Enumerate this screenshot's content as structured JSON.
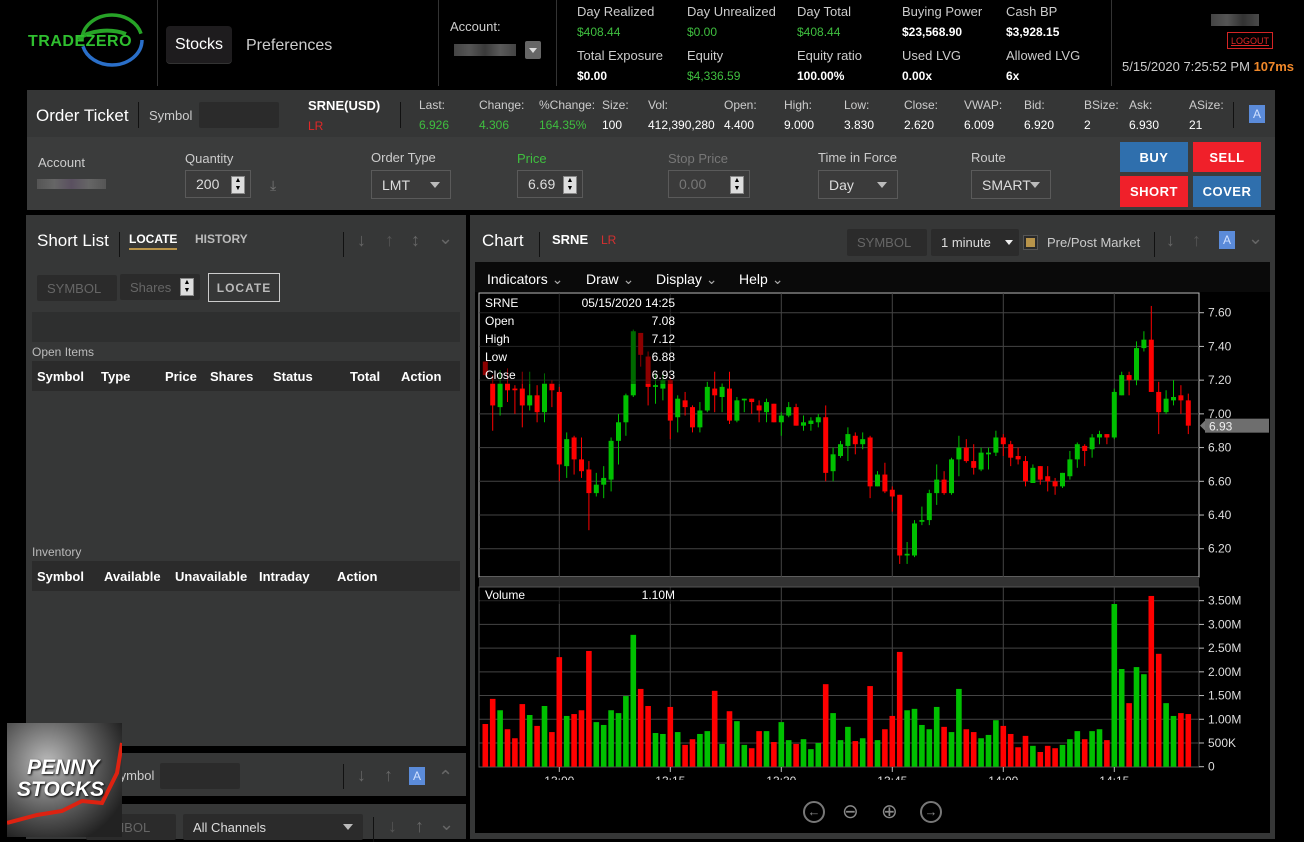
{
  "header": {
    "logo": "TRADEZERO",
    "nav": [
      {
        "label": "Stocks",
        "active": true
      },
      {
        "label": "Preferences",
        "active": false
      }
    ],
    "account_label": "Account:",
    "stats": [
      {
        "label": "Day Realized",
        "value": "$408.44",
        "color": "#3fbf3f"
      },
      {
        "label": "Total Exposure",
        "value": "$0.00",
        "color": "#ffffff"
      },
      {
        "label": "Day Unrealized",
        "value": "$0.00",
        "color": "#3fbf3f"
      },
      {
        "label": "Equity",
        "value": "$4,336.59",
        "color": "#3fbf3f"
      },
      {
        "label": "Day Total",
        "value": "$408.44",
        "color": "#3fbf3f"
      },
      {
        "label": "Equity ratio",
        "value": "100.00%",
        "color": "#ffffff"
      },
      {
        "label": "Buying Power",
        "value": "$23,568.90",
        "color": "#ffffff"
      },
      {
        "label": "Used LVG",
        "value": "0.00x",
        "color": "#ffffff"
      },
      {
        "label": "Cash BP",
        "value": "$3,928.15",
        "color": "#ffffff"
      },
      {
        "label": "Allowed LVG",
        "value": "6x",
        "color": "#ffffff"
      }
    ],
    "logout": "LOGOUT",
    "datetime": "5/15/2020 7:25:52 PM",
    "latency": "107ms"
  },
  "order_ticket": {
    "title": "Order Ticket",
    "symbol_label": "Symbol",
    "symbol": "SRNE(USD)",
    "route_tag": "LR",
    "a_button": "A",
    "quotes": [
      {
        "label": "Last:",
        "value": "6.926",
        "color": "#3fbf3f"
      },
      {
        "label": "Change:",
        "value": "4.306",
        "color": "#3fbf3f"
      },
      {
        "label": "%Change:",
        "value": "164.35%",
        "color": "#3fbf3f"
      },
      {
        "label": "Size:",
        "value": "100",
        "color": "#ffffff"
      },
      {
        "label": "Vol:",
        "value": "412,390,280",
        "color": "#ffffff"
      },
      {
        "label": "Open:",
        "value": "4.400",
        "color": "#ffffff"
      },
      {
        "label": "High:",
        "value": "9.000",
        "color": "#ffffff"
      },
      {
        "label": "Low:",
        "value": "3.830",
        "color": "#ffffff"
      },
      {
        "label": "Close:",
        "value": "2.620",
        "color": "#ffffff"
      },
      {
        "label": "VWAP:",
        "value": "6.009",
        "color": "#ffffff"
      },
      {
        "label": "Bid:",
        "value": "6.920",
        "color": "#ffffff"
      },
      {
        "label": "BSize:",
        "value": "2",
        "color": "#ffffff"
      },
      {
        "label": "Ask:",
        "value": "6.930",
        "color": "#ffffff"
      },
      {
        "label": "ASize:",
        "value": "21",
        "color": "#ffffff"
      }
    ],
    "form": {
      "account_label": "Account",
      "quantity_label": "Quantity",
      "quantity": "200",
      "order_type_label": "Order Type",
      "order_type": "LMT",
      "price_label": "Price",
      "price": "6.69",
      "stop_price_label": "Stop Price",
      "stop_price": "0.00",
      "tif_label": "Time in Force",
      "tif": "Day",
      "route_label": "Route",
      "route": "SMART"
    },
    "buttons": {
      "buy": "BUY",
      "sell": "SELL",
      "short": "SHORT",
      "cover": "COVER"
    },
    "colors": {
      "buy": "#2f6fad",
      "sell": "#f0202a"
    }
  },
  "short_list": {
    "title": "Short List",
    "tabs": [
      {
        "label": "LOCATE",
        "active": true
      },
      {
        "label": "HISTORY",
        "active": false
      }
    ],
    "symbol_placeholder": "SYMBOL",
    "shares_placeholder": "Shares",
    "locate_button": "LOCATE",
    "open_items_label": "Open Items",
    "open_items_columns": [
      "Symbol",
      "Type",
      "Price",
      "Shares",
      "Status",
      "Total",
      "Action"
    ],
    "inventory_label": "Inventory",
    "inventory_columns": [
      "Symbol",
      "Available",
      "Unavailable",
      "Intraday",
      "Action"
    ]
  },
  "bottom_panel": {
    "symbol_label": "Symbol",
    "a_button": "A"
  },
  "bottom_panel_2": {
    "symbol_placeholder": "SYMBOL",
    "channel": "All Channels"
  },
  "watermark": {
    "text_line1": "PENNY",
    "text_line2": "STOCKS"
  },
  "chart": {
    "title": "Chart",
    "symbol": "SRNE",
    "route_tag": "LR",
    "symbol_placeholder": "SYMBOL",
    "interval": "1 minute",
    "premarket_label": "Pre/Post Market",
    "a_button": "A",
    "menus": [
      "Indicators",
      "Draw",
      "Display",
      "Help"
    ],
    "info": {
      "symbol": "SRNE",
      "datetime": "05/15/2020 14:25",
      "open_label": "Open",
      "open": "7.08",
      "high_label": "High",
      "high": "7.12",
      "low_label": "Low",
      "low": "6.88",
      "close_label": "Close",
      "close": "6.93"
    },
    "volume_label": "Volume",
    "volume_value": "1.10M",
    "last_price": "6.93"
  },
  "chart_data": {
    "type": "candlestick",
    "interval": "1 minute",
    "start_time": "12:50",
    "x_ticks": [
      "13:00",
      "13:15",
      "13:30",
      "13:45",
      "14:00",
      "14:15"
    ],
    "price_ticks": [
      "7.60",
      "7.40",
      "7.20",
      "7.00",
      "6.80",
      "6.60",
      "6.40",
      "6.20"
    ],
    "volume_ticks": [
      "3.50M",
      "3.00M",
      "2.50M",
      "2.00M",
      "1.50M",
      "1.00M",
      "500K",
      "0"
    ],
    "ylim": [
      6.08,
      7.72
    ],
    "volume_ylim_millions": [
      0,
      3.7
    ],
    "grid": true,
    "colors": {
      "up": "#00c000",
      "down": "#ff0000"
    },
    "ohlc": [
      [
        7.31,
        7.31,
        7.23,
        7.23
      ],
      [
        7.18,
        7.23,
        6.9,
        7.05
      ],
      [
        7.04,
        7.26,
        6.99,
        7.18
      ],
      [
        7.18,
        7.27,
        7.07,
        7.14
      ],
      [
        7.15,
        7.17,
        7.0,
        7.14
      ],
      [
        7.15,
        7.25,
        6.92,
        7.05
      ],
      [
        7.05,
        7.25,
        7.02,
        7.11
      ],
      [
        7.11,
        7.17,
        6.95,
        7.01
      ],
      [
        7.01,
        7.24,
        6.95,
        7.18
      ],
      [
        7.18,
        7.2,
        7.04,
        7.14
      ],
      [
        7.13,
        7.16,
        6.6,
        6.7
      ],
      [
        6.69,
        6.89,
        6.62,
        6.85
      ],
      [
        6.86,
        6.87,
        6.64,
        6.73
      ],
      [
        6.73,
        6.86,
        6.62,
        6.66
      ],
      [
        6.67,
        6.72,
        6.31,
        6.53
      ],
      [
        6.53,
        6.65,
        6.51,
        6.58
      ],
      [
        6.58,
        6.69,
        6.5,
        6.62
      ],
      [
        6.61,
        6.86,
        6.54,
        6.84
      ],
      [
        6.84,
        7.0,
        6.7,
        6.95
      ],
      [
        6.95,
        7.12,
        6.87,
        7.11
      ],
      [
        7.11,
        7.5,
        7.1,
        7.49
      ],
      [
        7.48,
        7.48,
        7.28,
        7.35
      ],
      [
        7.34,
        7.37,
        7.05,
        7.16
      ],
      [
        7.16,
        7.24,
        7.06,
        7.17
      ],
      [
        7.15,
        7.24,
        7.08,
        7.2
      ],
      [
        7.2,
        7.22,
        6.85,
        6.96
      ],
      [
        6.98,
        7.11,
        6.89,
        7.09
      ],
      [
        7.08,
        7.13,
        6.99,
        7.04
      ],
      [
        7.04,
        7.05,
        6.89,
        6.92
      ],
      [
        6.92,
        7.07,
        6.89,
        7.02
      ],
      [
        7.02,
        7.19,
        7.01,
        7.16
      ],
      [
        7.15,
        7.25,
        7.01,
        7.11
      ],
      [
        7.1,
        7.18,
        7.01,
        7.16
      ],
      [
        7.15,
        7.25,
        6.94,
        6.96
      ],
      [
        6.96,
        7.1,
        6.95,
        7.08
      ],
      [
        7.08,
        7.09,
        7.01,
        7.09
      ],
      [
        7.09,
        7.09,
        7.0,
        7.07
      ],
      [
        7.05,
        7.08,
        6.95,
        7.02
      ],
      [
        7.01,
        7.09,
        6.95,
        7.07
      ],
      [
        7.06,
        7.06,
        6.95,
        6.95
      ],
      [
        6.95,
        7.01,
        6.87,
        6.99
      ],
      [
        6.99,
        7.07,
        6.98,
        7.04
      ],
      [
        7.04,
        7.06,
        6.93,
        6.93
      ],
      [
        6.93,
        6.99,
        6.9,
        6.95
      ],
      [
        6.94,
        6.98,
        6.9,
        6.96
      ],
      [
        6.95,
        7.0,
        6.92,
        6.98
      ],
      [
        6.98,
        7.05,
        6.6,
        6.65
      ],
      [
        6.66,
        6.8,
        6.6,
        6.76
      ],
      [
        6.75,
        6.84,
        6.74,
        6.82
      ],
      [
        6.81,
        6.92,
        6.72,
        6.88
      ],
      [
        6.87,
        6.89,
        6.76,
        6.82
      ],
      [
        6.82,
        6.89,
        6.79,
        6.85
      ],
      [
        6.86,
        6.87,
        6.5,
        6.57
      ],
      [
        6.57,
        6.66,
        6.57,
        6.64
      ],
      [
        6.64,
        6.71,
        6.53,
        6.54
      ],
      [
        6.55,
        6.57,
        6.42,
        6.51
      ],
      [
        6.52,
        6.52,
        6.11,
        6.16
      ],
      [
        6.16,
        6.24,
        6.11,
        6.17
      ],
      [
        6.16,
        6.37,
        6.15,
        6.35
      ],
      [
        6.36,
        6.45,
        6.34,
        6.37
      ],
      [
        6.37,
        6.55,
        6.34,
        6.53
      ],
      [
        6.53,
        6.7,
        6.46,
        6.61
      ],
      [
        6.61,
        6.66,
        6.52,
        6.53
      ],
      [
        6.53,
        6.74,
        6.52,
        6.73
      ],
      [
        6.73,
        6.87,
        6.63,
        6.8
      ],
      [
        6.8,
        6.85,
        6.71,
        6.72
      ],
      [
        6.72,
        6.82,
        6.64,
        6.68
      ],
      [
        6.67,
        6.8,
        6.66,
        6.77
      ],
      [
        6.76,
        6.8,
        6.67,
        6.77
      ],
      [
        6.77,
        6.9,
        6.75,
        6.86
      ],
      [
        6.86,
        6.88,
        6.75,
        6.82
      ],
      [
        6.82,
        6.84,
        6.69,
        6.74
      ],
      [
        6.75,
        6.8,
        6.7,
        6.73
      ],
      [
        6.72,
        6.75,
        6.57,
        6.6
      ],
      [
        6.59,
        6.7,
        6.59,
        6.68
      ],
      [
        6.69,
        6.69,
        6.58,
        6.61
      ],
      [
        6.63,
        6.69,
        6.54,
        6.6
      ],
      [
        6.6,
        6.62,
        6.52,
        6.57
      ],
      [
        6.57,
        6.65,
        6.56,
        6.65
      ],
      [
        6.63,
        6.78,
        6.61,
        6.73
      ],
      [
        6.73,
        6.83,
        6.68,
        6.82
      ],
      [
        6.81,
        6.82,
        6.69,
        6.78
      ],
      [
        6.79,
        6.88,
        6.74,
        6.86
      ],
      [
        6.86,
        6.9,
        6.82,
        6.88
      ],
      [
        6.88,
        6.88,
        6.82,
        6.86
      ],
      [
        6.86,
        7.15,
        6.85,
        7.13
      ],
      [
        7.11,
        7.25,
        7.11,
        7.23
      ],
      [
        7.23,
        7.25,
        7.11,
        7.2
      ],
      [
        7.2,
        7.43,
        7.17,
        7.39
      ],
      [
        7.39,
        7.49,
        7.37,
        7.44
      ],
      [
        7.44,
        7.64,
        7.13,
        7.13
      ],
      [
        7.13,
        7.19,
        6.88,
        7.01
      ],
      [
        7.01,
        7.14,
        7.0,
        7.09
      ],
      [
        7.08,
        7.2,
        7.05,
        7.1
      ],
      [
        7.11,
        7.17,
        7.0,
        7.08
      ],
      [
        7.08,
        7.12,
        6.88,
        6.93
      ]
    ],
    "volume_millions": [
      0.9,
      1.43,
      1.19,
      0.79,
      0.6,
      1.32,
      1.09,
      0.86,
      1.28,
      0.73,
      2.31,
      1.07,
      1.11,
      1.19,
      2.44,
      0.94,
      0.88,
      1.19,
      1.13,
      1.49,
      2.78,
      1.64,
      1.28,
      0.71,
      0.69,
      1.26,
      0.73,
      0.46,
      0.58,
      0.69,
      0.75,
      1.6,
      0.48,
      1.17,
      0.96,
      0.46,
      0.39,
      0.75,
      0.75,
      0.52,
      0.94,
      0.56,
      0.48,
      0.58,
      0.37,
      0.5,
      1.74,
      1.13,
      0.56,
      0.84,
      0.54,
      0.6,
      1.7,
      0.56,
      0.79,
      1.07,
      2.42,
      1.19,
      1.22,
      0.88,
      0.79,
      1.26,
      0.84,
      0.73,
      1.64,
      0.79,
      0.73,
      0.6,
      0.67,
      0.98,
      0.86,
      0.69,
      0.41,
      0.65,
      0.44,
      0.31,
      0.44,
      0.39,
      0.46,
      0.58,
      0.75,
      0.58,
      0.75,
      0.79,
      0.56,
      3.43,
      2.06,
      1.34,
      2.1,
      1.95,
      3.6,
      2.38,
      1.34,
      1.07,
      1.13,
      1.11
    ]
  }
}
